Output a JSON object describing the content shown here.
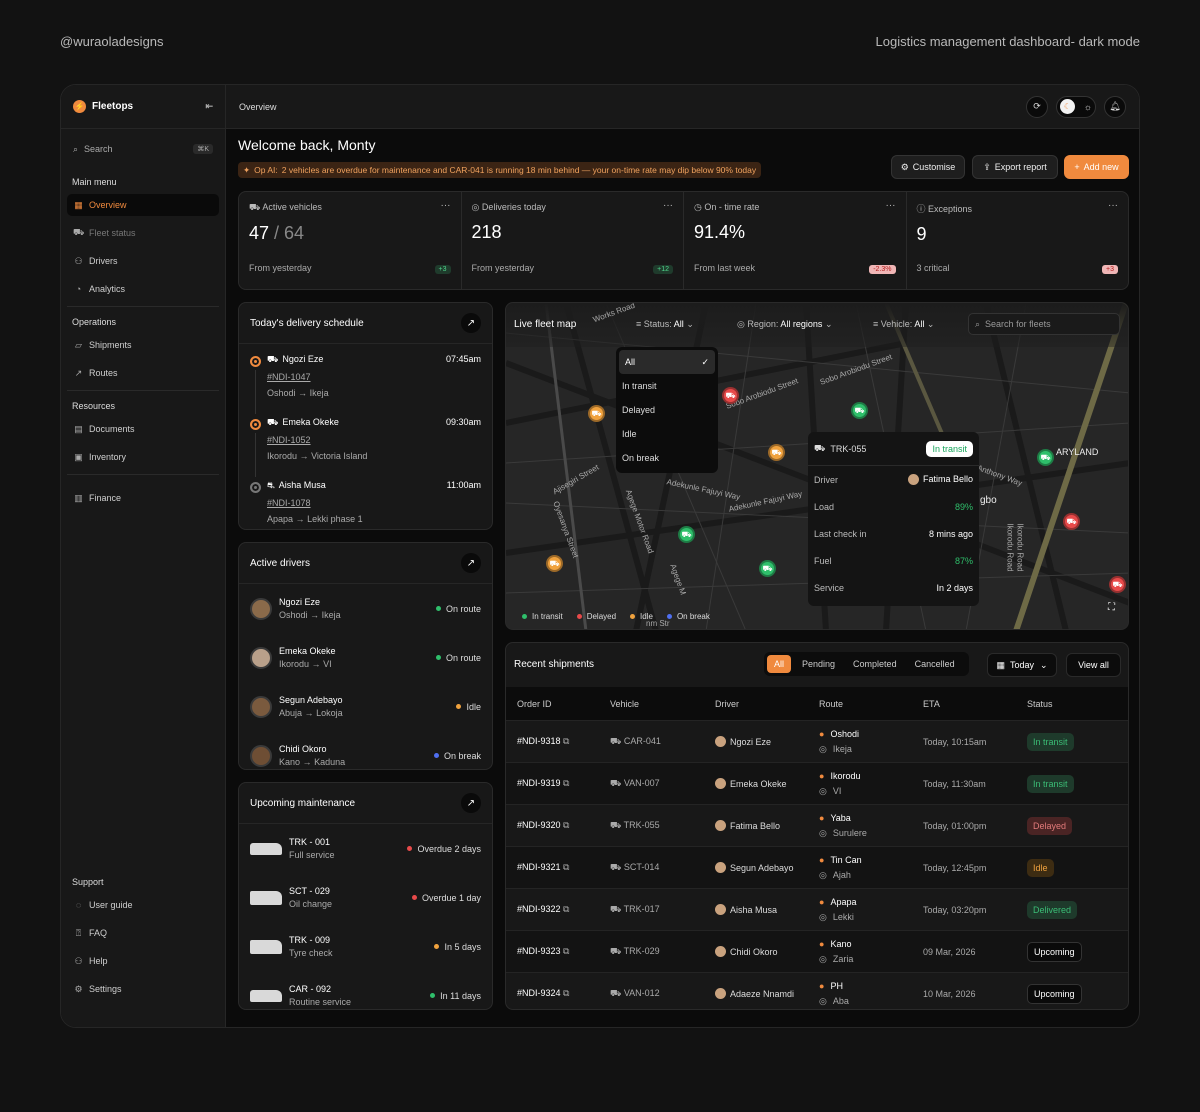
{
  "credit_left": "@wuraoladesigns",
  "credit_right": "Logistics management dashboard- dark mode",
  "brand": "Fleetops",
  "search": {
    "label": "Search",
    "shortcut": "⌘K"
  },
  "nav": {
    "main_title": "Main menu",
    "main": [
      "Overview",
      "Fleet status",
      "Drivers",
      "Analytics"
    ],
    "ops_title": "Operations",
    "ops": [
      "Shipments",
      "Routes"
    ],
    "res_title": "Resources",
    "res": [
      "Documents",
      "Inventory"
    ],
    "finance": "Finance",
    "support_title": "Support",
    "support": [
      "User guide",
      "FAQ",
      "Help",
      "Settings"
    ]
  },
  "topbar": {
    "title": "Overview"
  },
  "welcome": "Welcome back, Monty",
  "alert": {
    "prefix": "Op AI:",
    "text": "2 vehicles are overdue for maintenance and CAR-041 is running 18 min behind — your on-time rate may dip below 90% today"
  },
  "actions": {
    "customise": "Customise",
    "export": "Export report",
    "add": "Add new"
  },
  "stats": [
    {
      "label": "Active vehicles",
      "value": "47",
      "total": "/ 64",
      "sub": "From yesterday",
      "badge": "+3",
      "tone": "green"
    },
    {
      "label": "Deliveries today",
      "value": "218",
      "total": "",
      "sub": "From yesterday",
      "badge": "+12",
      "tone": "green"
    },
    {
      "label": "On - time rate",
      "value": "91.4%",
      "total": "",
      "sub": "From last week",
      "badge": "-2.3%",
      "tone": "red"
    },
    {
      "label": "Exceptions",
      "value": "9",
      "total": "",
      "sub": "3 critical",
      "badge": "+3",
      "tone": "red"
    }
  ],
  "schedule": {
    "title": "Today's delivery schedule",
    "items": [
      {
        "name": "Ngozi Eze",
        "time": "07:45am",
        "id": "#NDI-1047",
        "from": "Oshodi",
        "to": "Ikeja"
      },
      {
        "name": "Emeka Okeke",
        "time": "09:30am",
        "id": "#NDI-1052",
        "from": "Ikorodu",
        "to": "Victoria Island"
      },
      {
        "name": "Aisha Musa",
        "time": "11:00am",
        "id": "#NDI-1078",
        "from": "Apapa",
        "to": "Lekki phase 1"
      }
    ]
  },
  "drivers": {
    "title": "Active drivers",
    "items": [
      {
        "name": "Ngozi Eze",
        "from": "Oshodi",
        "to": "Ikeja",
        "status": "On route",
        "color": "#2fbf6b"
      },
      {
        "name": "Emeka Okeke",
        "from": "Ikorodu",
        "to": "VI",
        "status": "On route",
        "color": "#2fbf6b"
      },
      {
        "name": "Segun Adebayo",
        "from": "Abuja",
        "to": "Lokoja",
        "status": "Idle",
        "color": "#f0a23e"
      },
      {
        "name": "Chidi Okoro",
        "from": "Kano",
        "to": "Kaduna",
        "status": "On break",
        "color": "#4f6ff0"
      }
    ]
  },
  "maintenance": {
    "title": "Upcoming maintenance",
    "items": [
      {
        "name": "TRK - 001",
        "desc": "Full service",
        "status": "Overdue 2 days",
        "color": "#e84a4a"
      },
      {
        "name": "SCT - 029",
        "desc": "Oil change",
        "status": "Overdue 1 day",
        "color": "#e84a4a"
      },
      {
        "name": "TRK - 009",
        "desc": "Tyre check",
        "status": "In 5 days",
        "color": "#f0a23e"
      },
      {
        "name": "CAR - 092",
        "desc": "Routine service",
        "status": "In 11 days",
        "color": "#2fbf6b"
      }
    ]
  },
  "map": {
    "title": "Live fleet map",
    "status_label": "Status:",
    "status_value": "All",
    "region_label": "Region:",
    "region_value": "All regions",
    "vehicle_label": "Vehicle:",
    "vehicle_value": "All",
    "search_placeholder": "Search for fleets",
    "dropdown": [
      "All",
      "In transit",
      "Delayed",
      "Idle",
      "On break"
    ],
    "streets": [
      "Works Road",
      "Sobo Arobiodu Street",
      "Sobo Arobiodu Street",
      "Adekunle Fajuyi Way",
      "Adekunle Fajuyi Way",
      "Ajisegiri Street",
      "Oyesanya Street",
      "Agege Motor Road",
      "Agege M",
      "Anthony Way",
      "ARYLAND",
      "gbo",
      "Ikorodu Road",
      "Ikorodu Road",
      "nm Str"
    ],
    "popup": {
      "id": "TRK-055",
      "status": "In transit",
      "rows": [
        {
          "label": "Driver",
          "value": "Fatima Bello"
        },
        {
          "label": "Load",
          "value": "89%"
        },
        {
          "label": "Last check in",
          "value": "8 mins ago"
        },
        {
          "label": "Fuel",
          "value": "87%"
        },
        {
          "label": "Service",
          "value": "In 2 days"
        }
      ]
    },
    "legend": [
      {
        "label": "In transit",
        "color": "#2fbf6b"
      },
      {
        "label": "Delayed",
        "color": "#e84a4a"
      },
      {
        "label": "Idle",
        "color": "#f0a23e"
      },
      {
        "label": "On break",
        "color": "#4f6ff0"
      }
    ]
  },
  "shipments": {
    "title": "Recent shipments",
    "tabs": [
      "All",
      "Pending",
      "Completed",
      "Cancelled"
    ],
    "period": "Today",
    "view_all": "View all",
    "columns": [
      "Order ID",
      "Vehicle",
      "Driver",
      "Route",
      "ETA",
      "Status"
    ],
    "rows": [
      {
        "id": "#NDI-9318",
        "vehicle": "CAR-041",
        "driver": "Ngozi Eze",
        "from": "Oshodi",
        "to": "Ikeja",
        "eta": "Today, 10:15am",
        "status": "In transit",
        "tone": "tr"
      },
      {
        "id": "#NDI-9319",
        "vehicle": "VAN-007",
        "driver": "Emeka Okeke",
        "from": "Ikorodu",
        "to": "VI",
        "eta": "Today, 11:30am",
        "status": "In transit",
        "tone": "tr"
      },
      {
        "id": "#NDI-9320",
        "vehicle": "TRK-055",
        "driver": "Fatima Bello",
        "from": "Yaba",
        "to": "Surulere",
        "eta": "Today, 01:00pm",
        "status": "Delayed",
        "tone": "del"
      },
      {
        "id": "#NDI-9321",
        "vehicle": "SCT-014",
        "driver": "Segun Adebayo",
        "from": "Tin Can",
        "to": "Ajah",
        "eta": "Today, 12:45pm",
        "status": "Idle",
        "tone": "idle"
      },
      {
        "id": "#NDI-9322",
        "vehicle": "TRK-017",
        "driver": "Aisha Musa",
        "from": "Apapa",
        "to": "Lekki",
        "eta": "Today, 03:20pm",
        "status": "Delivered",
        "tone": "done"
      },
      {
        "id": "#NDI-9323",
        "vehicle": "TRK-029",
        "driver": "Chidi Okoro",
        "from": "Kano",
        "to": "Zaria",
        "eta": "09 Mar, 2026",
        "status": "Upcoming",
        "tone": "up"
      },
      {
        "id": "#NDI-9324",
        "vehicle": "VAN-012",
        "driver": "Adaeze Nnamdi",
        "from": "PH",
        "to": "Aba",
        "eta": "10 Mar, 2026",
        "status": "Upcoming",
        "tone": "up"
      }
    ]
  }
}
